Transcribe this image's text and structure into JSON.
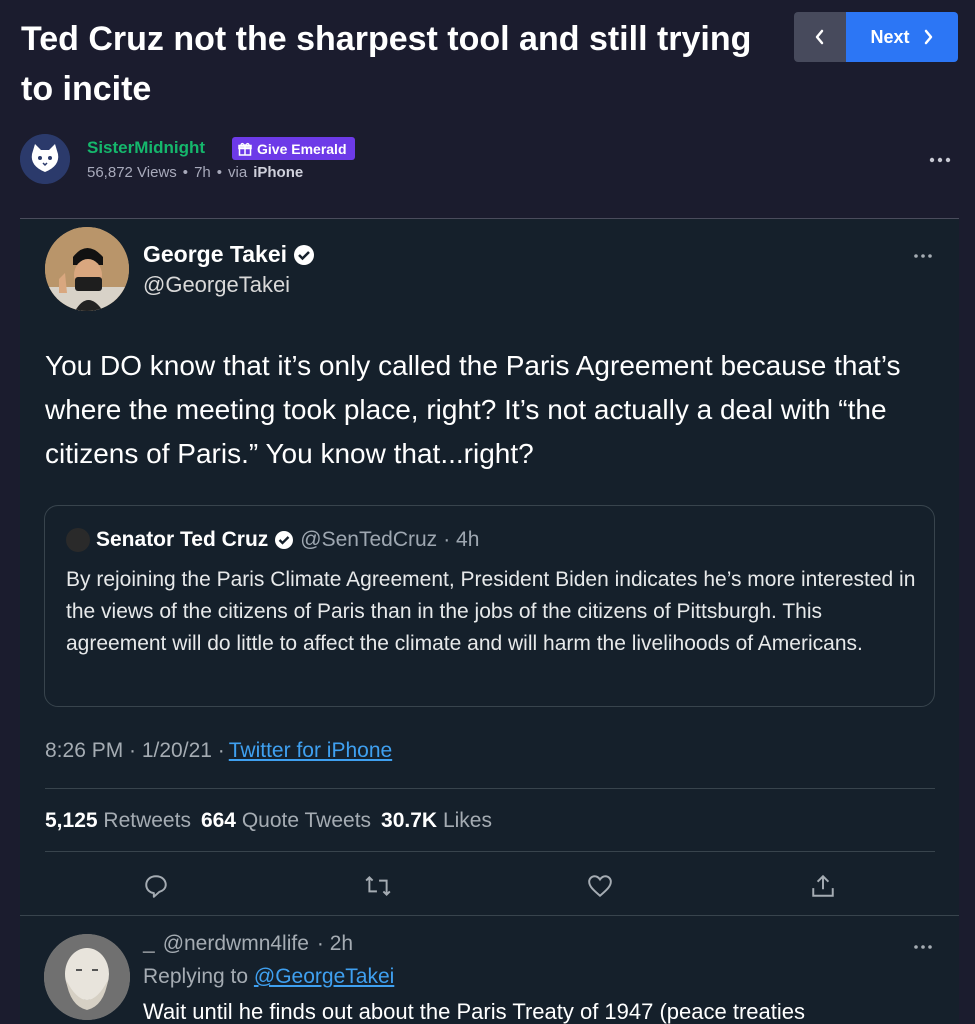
{
  "post": {
    "title": "Ted Cruz not the sharpest tool and still trying to incite",
    "author": "SisterMidnight",
    "give_emerald_label": "Give Emerald",
    "views": "56,872 Views",
    "time_ago": "7h",
    "via_label": "via",
    "via_source": "iPhone"
  },
  "nav": {
    "prev_icon": "chevron-left-icon",
    "next_label": "Next",
    "next_icon": "chevron-right-icon"
  },
  "tweet": {
    "name": "George Takei",
    "handle": "@GeorgeTakei",
    "text": "You DO know that it’s only called the Paris Agreement because that’s where the meeting took place, right? It’s not actually a deal with “the citizens of Paris.” You know that...right?",
    "quote": {
      "name": "Senator Ted Cruz",
      "handle": "@SenTedCruz",
      "time": "· 4h",
      "text": "By rejoining the Paris Climate Agreement, President Biden indicates he’s more interested in the views of the citizens of Paris than in the jobs of the citizens of Pittsburgh. This agreement will do little to affect the climate and will harm the livelihoods of Americans."
    },
    "time": "8:26 PM · 1/20/21 ·",
    "source": "Twitter for iPhone",
    "retweets": "5,125",
    "retweets_label": "Retweets",
    "quotes": "664",
    "quotes_label": "Quote Tweets",
    "likes": "30.7K",
    "likes_label": "Likes"
  },
  "reply": {
    "name": "_",
    "handle": "@nerdwmn4life",
    "time": "· 2h",
    "replying_label": "Replying to",
    "replying_to": "@GeorgeTakei",
    "text": "Wait until he finds out about the Paris Treaty of 1947 (peace treaties"
  },
  "colors": {
    "background": "#1b1c2e",
    "tweet_background": "#15202b",
    "username": "#15b76c",
    "emerald": "#6d3ae8",
    "next_button": "#2c76f5",
    "link": "#3fa0f0"
  }
}
